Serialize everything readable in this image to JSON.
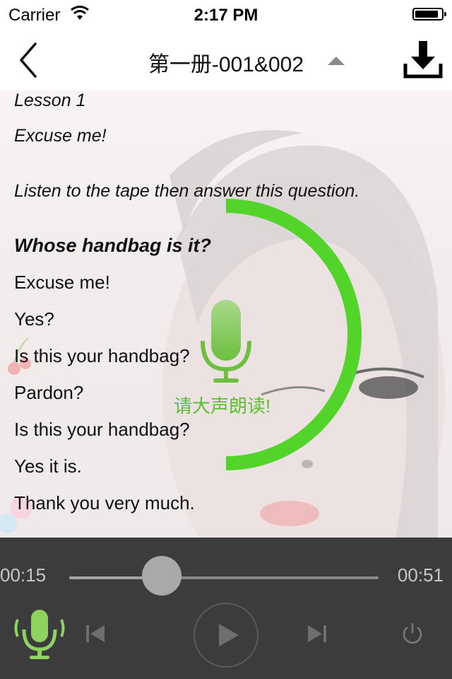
{
  "status_bar": {
    "carrier": "Carrier",
    "time": "2:17 PM",
    "battery_level": 0.9
  },
  "nav": {
    "title": "第一册-001&002"
  },
  "lesson": {
    "lines": [
      "Lesson 1",
      "Excuse me!",
      "Listen to the tape then answer this question.",
      "Whose handbag is it?",
      "Excuse me!",
      "Yes?",
      "Is this your handbag?",
      "Pardon?",
      "Is this your handbag?",
      "Yes it is.",
      "Thank you very much."
    ]
  },
  "recording": {
    "prompt": "请大声朗读!",
    "progress": 0.5,
    "accent_color": "#52d42a"
  },
  "player": {
    "elapsed": "00:15",
    "total": "00:51",
    "progress": 0.3
  },
  "colors": {
    "player_bg": "#3c3c3c",
    "accent_green": "#5cc12e"
  },
  "icons": [
    "back-chevron-icon",
    "caret-up-icon",
    "download-icon",
    "microphone-icon",
    "skip-previous-icon",
    "play-icon",
    "skip-next-icon",
    "power-icon"
  ]
}
